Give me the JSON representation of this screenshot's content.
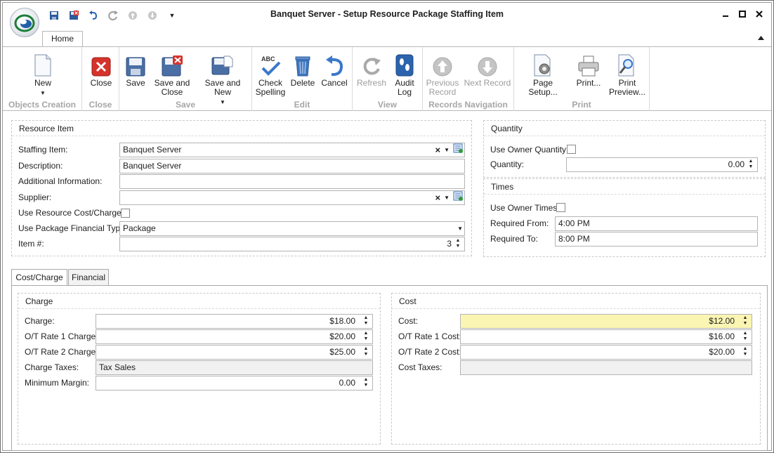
{
  "window": {
    "title": "Banquet Server - Setup Resource Package Staffing Item",
    "controls": {
      "minimize": "▁",
      "maximize": "■",
      "close": "✕"
    },
    "qat_icons": [
      "save-icon",
      "save-and-close-icon",
      "undo-icon",
      "redo-icon",
      "up-icon",
      "down-icon",
      "customize-icon"
    ]
  },
  "ribbon": {
    "tab_home": "Home",
    "collapse": "▲",
    "groups": {
      "objects_creation": "Objects Creation",
      "close": "Close",
      "save": "Save",
      "edit": "Edit",
      "view": "View",
      "records_navigation": "Records Navigation",
      "print": "Print"
    },
    "buttons": {
      "new": "New",
      "close": "Close",
      "save": "Save",
      "save_and_close_1": "Save and",
      "save_and_close_2": "Close",
      "save_and_new": "Save and New",
      "check_spelling_1": "Check",
      "check_spelling_2": "Spelling",
      "delete": "Delete",
      "cancel": "Cancel",
      "refresh": "Refresh",
      "audit_log_1": "Audit",
      "audit_log_2": "Log",
      "previous_record_1": "Previous",
      "previous_record_2": "Record",
      "next_record": "Next Record",
      "page_setup": "Page Setup...",
      "print": "Print...",
      "print_preview_1": "Print",
      "print_preview_2": "Preview..."
    }
  },
  "resource_item": {
    "title": "Resource Item",
    "staffing_item_label": "Staffing Item:",
    "staffing_item_value": "Banquet Server",
    "description_label": "Description:",
    "description_value": "Banquet Server",
    "additional_info_label": "Additional Information:",
    "additional_info_value": "",
    "supplier_label": "Supplier:",
    "supplier_value": "",
    "use_resource_cost_label": "Use Resource Cost/Charge:",
    "use_resource_cost_checked": false,
    "use_package_financial_type_label": "Use Package Financial Type:",
    "use_package_financial_type_value": "Package",
    "item_no_label": "Item #:",
    "item_no_value": "3"
  },
  "quantity": {
    "title": "Quantity",
    "use_owner_quantity_label": "Use Owner Quantity:",
    "use_owner_quantity_checked": false,
    "quantity_label": "Quantity:",
    "quantity_value": "0.00"
  },
  "times": {
    "title": "Times",
    "use_owner_times_label": "Use Owner Times:",
    "use_owner_times_checked": false,
    "required_from_label": "Required From:",
    "required_from_value": "4:00 PM",
    "required_to_label": "Required To:",
    "required_to_value": "8:00 PM"
  },
  "lower_tabs": {
    "cost_charge": "Cost/Charge",
    "financial": "Financial"
  },
  "charge": {
    "title": "Charge",
    "charge_label": "Charge:",
    "charge_value": "$18.00",
    "ot1_label": "O/T Rate 1 Charge:",
    "ot1_value": "$20.00",
    "ot2_label": "O/T Rate 2 Charge:",
    "ot2_value": "$25.00",
    "taxes_label": "Charge Taxes:",
    "taxes_value": "Tax Sales",
    "min_margin_label": "Minimum Margin:",
    "min_margin_value": "0.00"
  },
  "cost": {
    "title": "Cost",
    "cost_label": "Cost:",
    "cost_value": "$12.00",
    "ot1_label": "O/T Rate 1 Cost:",
    "ot1_value": "$16.00",
    "ot2_label": "O/T Rate 2 Cost:",
    "ot2_value": "$20.00",
    "taxes_label": "Cost Taxes:",
    "taxes_value": ""
  },
  "colors": {
    "highlight_field": "#fbf5b3",
    "readonly_field": "#f1f1f1",
    "group_label": "#a6a6a6"
  }
}
